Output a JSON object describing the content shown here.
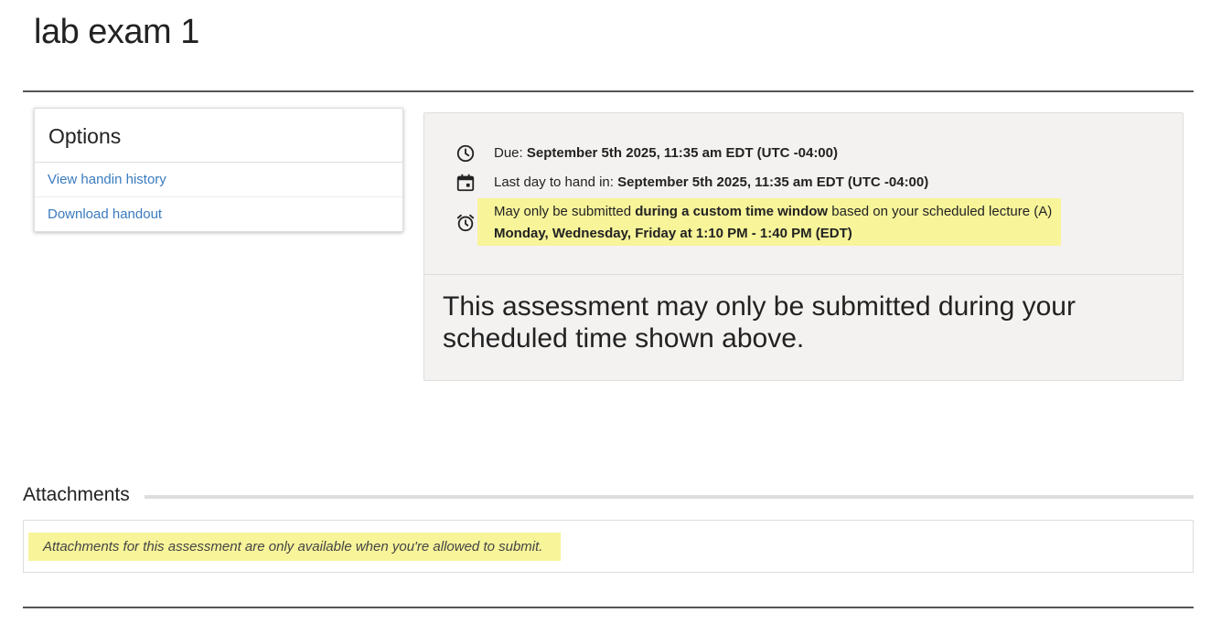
{
  "page": {
    "title": "lab exam 1"
  },
  "options": {
    "title": "Options",
    "links": [
      "View handin history",
      "Download handout"
    ]
  },
  "info": {
    "due_label": "Due: ",
    "due_value": "September 5th 2025, 11:35 am EDT (UTC -04:00)",
    "last_day_label": "Last day to hand in: ",
    "last_day_value": "September 5th 2025, 11:35 am EDT (UTC -04:00)",
    "window_prefix": "May only be submitted ",
    "window_bold": "during a custom time window",
    "window_suffix": " based on your scheduled lecture (A)",
    "window_schedule": "Monday, Wednesday, Friday at 1:10 PM - 1:40 PM (EDT)",
    "notice": "This assessment may only be submitted during your scheduled time shown above."
  },
  "attachments": {
    "heading": "Attachments",
    "note": "Attachments for this assessment are only available when you're allowed to submit."
  },
  "icons": {
    "due": "clock-icon",
    "last_day": "calendar-icon",
    "window": "alarm-clock-icon"
  },
  "colors": {
    "highlight": "#f7f49a",
    "link": "#3a7bbf",
    "panel_bg": "#f4f2f1"
  }
}
